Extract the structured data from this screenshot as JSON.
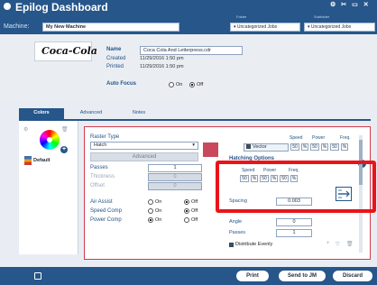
{
  "titlebar": {
    "title": "Epilog Dashboard",
    "machine_label": "Machine:",
    "machine_value": "My New Machine",
    "folder_label": "Folder",
    "folder_value": "Uncategorized Jobs",
    "subfolder_label": "Subfolder",
    "subfolder_value": "Uncategorized Jobs"
  },
  "job": {
    "thumbnail_text": "Coca-Cola",
    "name_label": "Name",
    "name_value": "Coca Cola And Letterpress.cdr",
    "created_label": "Created",
    "created_value": "11/29/2016 1:50 pm",
    "printed_label": "Printed",
    "printed_value": "11/29/2016 1:50 pm",
    "autofocus_label": "Auto Focus",
    "autofocus_on": "On",
    "autofocus_off": "Off",
    "autofocus_selected": "off"
  },
  "tabs": [
    "Colors",
    "Advanced",
    "Notes"
  ],
  "active_tab": "Colors",
  "color_panel": {
    "default_label": "Default"
  },
  "raster": {
    "type_label": "Raster Type",
    "type_value": "Hatch",
    "advanced_label": "Advanced",
    "passes_label": "Passes",
    "passes_value": "1",
    "thickness_label": "Thickness",
    "thickness_value": "0",
    "offset_label": "Offset",
    "offset_value": "0",
    "air_assist_label": "Air Assist",
    "speed_comp_label": "Speed Comp",
    "power_comp_label": "Power Comp",
    "on_label": "On",
    "off_label": "Off",
    "air_assist_selected": "off",
    "speed_comp_selected": "off",
    "power_comp_selected": "on"
  },
  "vector": {
    "label": "Vector",
    "checked": true,
    "headers": [
      "Speed",
      "Power",
      "Freq."
    ],
    "values": [
      "50",
      "%",
      "50",
      "%",
      "50",
      "%"
    ]
  },
  "hatching": {
    "label": "Hatching Options",
    "headers": [
      "Speed",
      "Power",
      "Freq."
    ],
    "values": [
      "50",
      "%",
      "50",
      "%",
      "50",
      "%"
    ],
    "spacing_label": "Spacing",
    "spacing_value": "0.003",
    "angle_label": "Angle",
    "angle_value": "0",
    "passes_label": "Passes",
    "passes_value": "1",
    "distribute_label": "Distribute Evenly"
  },
  "footer": {
    "print_label": "Print",
    "send_label": "Send to JM",
    "discard_label": "Discard"
  },
  "colors": {
    "brand_blue": "#26568a",
    "highlight_red": "#e8141a"
  }
}
